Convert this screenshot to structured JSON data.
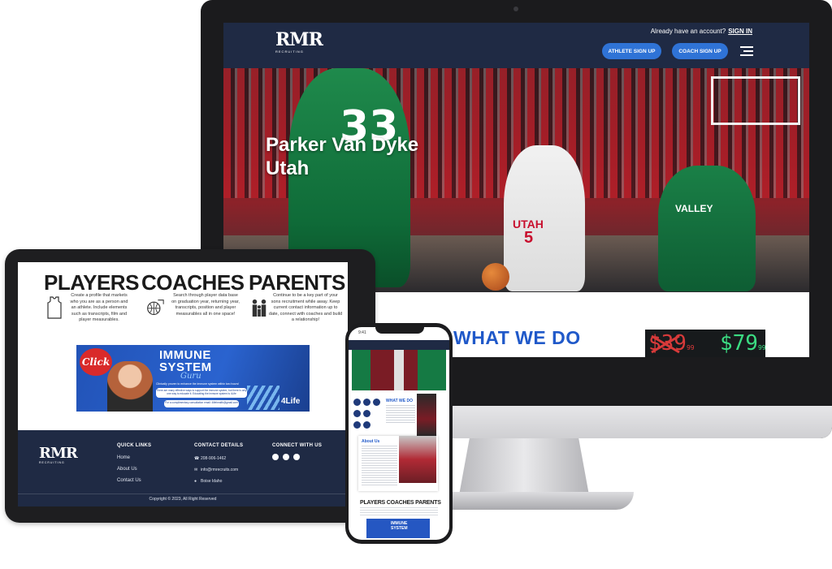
{
  "desktop": {
    "logo": "RMR",
    "logo_sub": "RECRUITING",
    "account_prompt": "Already have an account?",
    "sign_in": "SIGN IN",
    "athlete_signup": "ATHLETE SIGN UP",
    "coach_signup": "COACH SIGN UP",
    "hero_title_line1": "Parker Van Dyke",
    "hero_title_line2": "Utah",
    "jersey_33": "33",
    "jersey_utah": "UTAH",
    "jersey_5": "5",
    "jersey_valley": "VALLEY",
    "section_title": "WHAT WE DO",
    "old_price": "$39",
    "old_cents": "99",
    "new_price": "$79",
    "new_cents": "99"
  },
  "tablet": {
    "players": {
      "heading": "PLAYERS",
      "text": "Create a profile that markets who you are as a person and an athlete. Include elements such as transcripts, film and player measurables."
    },
    "coaches": {
      "heading": "COACHES",
      "text": "Search through player data base on graduation year, returning year, transcripts, position and player measurables all in one space!"
    },
    "parents": {
      "heading": "PARENTS",
      "text": "Continue to be a key part of your sons recruitment while away. Keep current contact information up to date, connect with coaches and build a relationship!"
    },
    "banner": {
      "click": "Click",
      "title1": "IMMUNE",
      "title2": "SYSTEM",
      "guru": "Guru",
      "sub": "Clinically proven to enhance the immune system within two hours!",
      "box1": "There are many effective ways to support the immune system, but there is only one way to educate it. Educating the immune system is 4Life",
      "box2": "For a complimentary consultation email: 4lifehealth@gmail.com",
      "brand": "4Life"
    },
    "footer": {
      "logo": "RMR",
      "logo_sub": "RECRUITING",
      "quick_links_heading": "QUICK LINKS",
      "quick_links": [
        "Home",
        "About Us",
        "Contact Us"
      ],
      "contact_heading": "CONTACT DETAILS",
      "phone": "208-906-1462",
      "email": "info@rmrecruits.com",
      "location": "Boise Idaho",
      "connect_heading": "CONNECT WITH US",
      "copyright": "Copyright © 2023, All Right Reserved"
    }
  },
  "phone": {
    "time": "9:41",
    "what_we_do": "WHAT WE DO",
    "about_us": "About Us",
    "players": "PLAYERS",
    "coaches": "COACHES",
    "parents": "PARENTS",
    "banner_line1": "IMMUNE",
    "banner_line2": "SYSTEM"
  },
  "colors": {
    "navy": "#1f2a44",
    "accent_blue": "#2f73d6",
    "heading_blue": "#2059c9",
    "price_red": "#d83a3a",
    "price_green": "#3bdc82"
  }
}
